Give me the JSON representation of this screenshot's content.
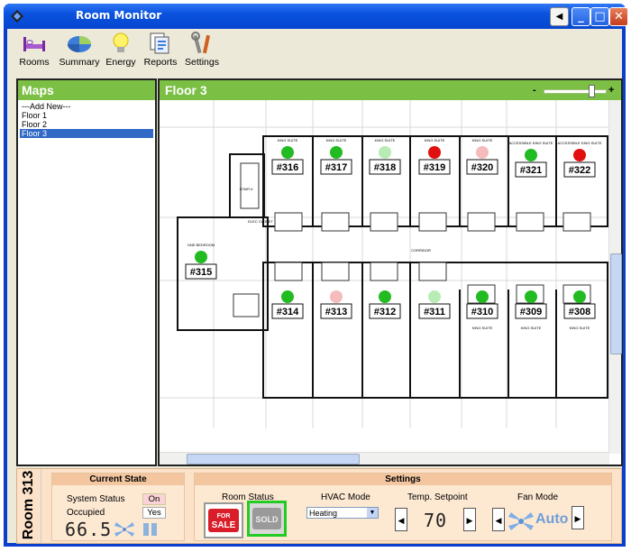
{
  "window": {
    "title": "Room Monitor"
  },
  "toolbar": [
    {
      "label": "Rooms",
      "icon": "bed-icon"
    },
    {
      "label": "Summary",
      "icon": "pie-chart-icon"
    },
    {
      "label": "Energy",
      "icon": "lightbulb-icon"
    },
    {
      "label": "Reports",
      "icon": "reports-icon"
    },
    {
      "label": "Settings",
      "icon": "tools-icon"
    }
  ],
  "maps": {
    "title": "Maps",
    "items": [
      "---Add New---",
      "Floor 1",
      "Floor 2",
      "Floor 3"
    ],
    "selected": "Floor 3"
  },
  "floor": {
    "title": "Floor 3",
    "zoom_minus": "-",
    "zoom_plus": "+",
    "rooms": [
      {
        "label": "#316",
        "status": "green",
        "caption": "KING SUITE"
      },
      {
        "label": "#317",
        "status": "green",
        "caption": "KING SUITE"
      },
      {
        "label": "#318",
        "status": "lightgreen",
        "caption": "KING SUITE"
      },
      {
        "label": "#319",
        "status": "red",
        "caption": "KING SUITE"
      },
      {
        "label": "#320",
        "status": "pink",
        "caption": "KING SUITE"
      },
      {
        "label": "#321",
        "status": "green",
        "caption": "ACCESSIBLE KING SUITE"
      },
      {
        "label": "#322",
        "status": "red",
        "caption": "ACCESSIBLE KING SUITE"
      },
      {
        "label": "#315",
        "status": "green",
        "caption": "ONE BEDROOM"
      },
      {
        "label": "#314",
        "status": "green",
        "caption": ""
      },
      {
        "label": "#313",
        "status": "pink",
        "caption": ""
      },
      {
        "label": "#312",
        "status": "green",
        "caption": ""
      },
      {
        "label": "#311",
        "status": "lightgreen",
        "caption": ""
      },
      {
        "label": "#310",
        "status": "green",
        "caption": "KING SUITE"
      },
      {
        "label": "#309",
        "status": "green",
        "caption": "KING SUITE"
      },
      {
        "label": "#308",
        "status": "green",
        "caption": "KING SUITE"
      }
    ],
    "status_colors": {
      "green": "#22bb22",
      "lightgreen": "#b9ecb4",
      "red": "#e01010",
      "pink": "#f4bcbc"
    },
    "corridor_labels": [
      "STAIR #",
      "ELEC CLOSET",
      "CORRIDOR"
    ]
  },
  "room_panel": {
    "title": "Room 313",
    "current_state": {
      "header": "Current State",
      "system_status_label": "System Status",
      "system_status_value": "On",
      "occupied_label": "Occupied",
      "occupied_value": "Yes",
      "temperature": "66.5"
    },
    "settings": {
      "header": "Settings",
      "room_status_label": "Room Status",
      "for_sale_line1": "FOR",
      "for_sale_line2": "SALE",
      "sold_label": "SOLD",
      "hvac_label": "HVAC Mode",
      "hvac_value": "Heating",
      "setpoint_label": "Temp. Setpoint",
      "setpoint_value": "70",
      "fan_label": "Fan Mode",
      "fan_value": "Auto"
    }
  },
  "colors": {
    "accent_green": "#7bbf44",
    "titlebar_blue": "#0a52de",
    "panel_peach": "#fbe2c8"
  }
}
